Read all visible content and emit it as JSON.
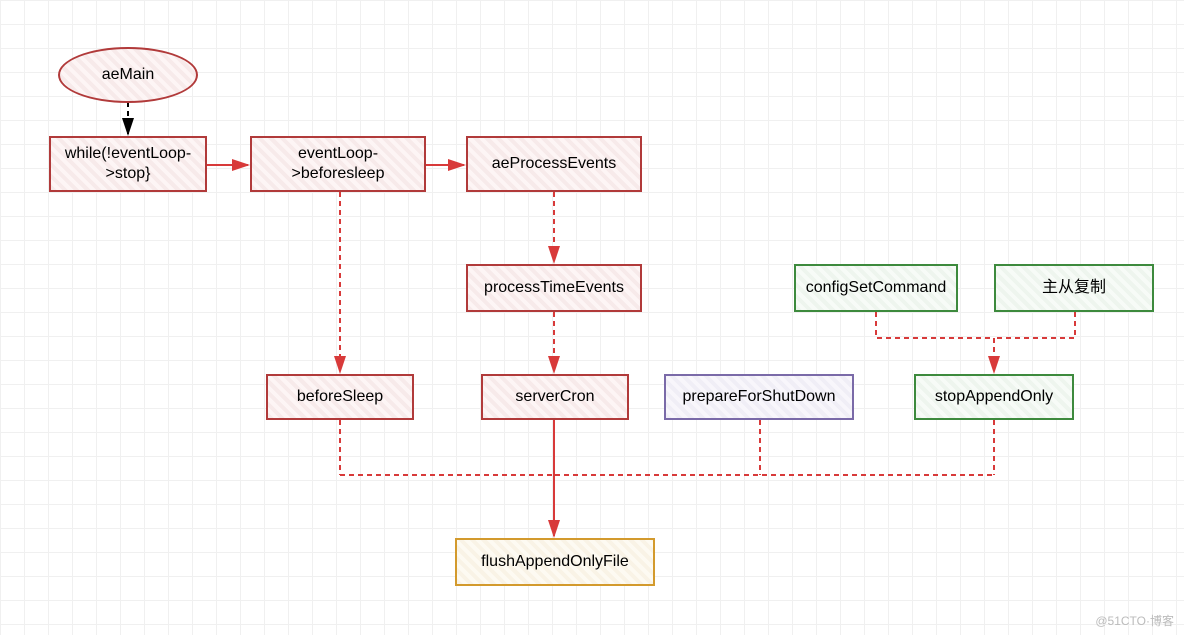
{
  "diagram": {
    "nodes": {
      "aeMain": "aeMain",
      "whileStop": "while(!eventLoop->stop}",
      "beforesleepPtr": "eventLoop->beforesleep",
      "aeProcessEvents": "aeProcessEvents",
      "processTimeEvents": "processTimeEvents",
      "beforeSleep": "beforeSleep",
      "serverCron": "serverCron",
      "prepareForShutDown": "prepareForShutDown",
      "configSetCommand": "configSetCommand",
      "masterSlave": "主从复制",
      "stopAppendOnly": "stopAppendOnly",
      "flushAppendOnlyFile": "flushAppendOnlyFile"
    },
    "colors": {
      "red": "#b13a3a",
      "green": "#3d8a3d",
      "purple": "#7a6aa8",
      "orange": "#d39a2d",
      "arrowRed": "#d83a3a",
      "arrowBlack": "#000000"
    },
    "watermark": "@51CTO·博客"
  }
}
